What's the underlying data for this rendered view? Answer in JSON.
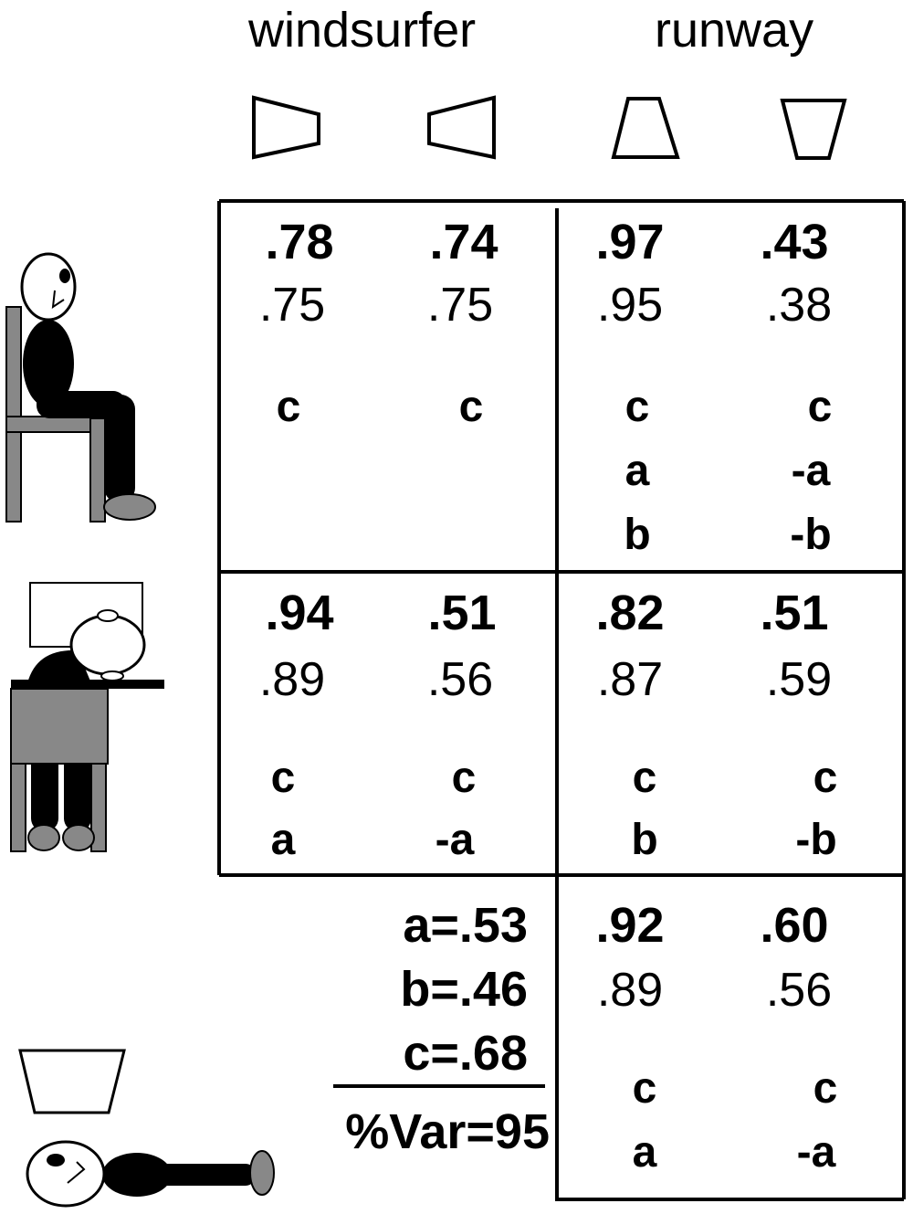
{
  "headers": {
    "left": "windsurfer",
    "right": "runway"
  },
  "shape_icons": [
    "trapezoid-left-narrow-icon",
    "trapezoid-right-narrow-icon",
    "trapezoid-up-narrow-icon",
    "trapezoid-down-narrow-icon"
  ],
  "figure_icons": [
    "sitting-person-icon",
    "person-at-desk-icon",
    "lying-person-icon",
    "trapezoid-down-narrow-icon"
  ],
  "rows": [
    {
      "name": "sitting",
      "cells": [
        {
          "top": ".78",
          "mid": ".75",
          "letters": [
            "c"
          ]
        },
        {
          "top": ".74",
          "mid": ".75",
          "letters": [
            "c"
          ]
        },
        {
          "top": ".97",
          "mid": ".95",
          "letters": [
            "c",
            "a",
            "b"
          ]
        },
        {
          "top": ".43",
          "mid": ".38",
          "letters": [
            "c",
            "-a",
            "-b"
          ]
        }
      ]
    },
    {
      "name": "desk",
      "cells": [
        {
          "top": ".94",
          "mid": ".89",
          "letters": [
            "c",
            "a"
          ]
        },
        {
          "top": ".51",
          "mid": ".56",
          "letters": [
            "c",
            "-a"
          ]
        },
        {
          "top": ".82",
          "mid": ".87",
          "letters": [
            "c",
            "b"
          ]
        },
        {
          "top": ".51",
          "mid": ".59",
          "letters": [
            "c",
            "-b"
          ]
        }
      ]
    },
    {
      "name": "lying",
      "cells": [
        {
          "top": ".92",
          "mid": ".89",
          "letters": [
            "c",
            "a"
          ]
        },
        {
          "top": ".60",
          "mid": ".56",
          "letters": [
            "c",
            "-a"
          ]
        }
      ]
    }
  ],
  "params": {
    "a": "a=.53",
    "b": "b=.46",
    "c": "c=.68",
    "var": "%Var=95"
  }
}
